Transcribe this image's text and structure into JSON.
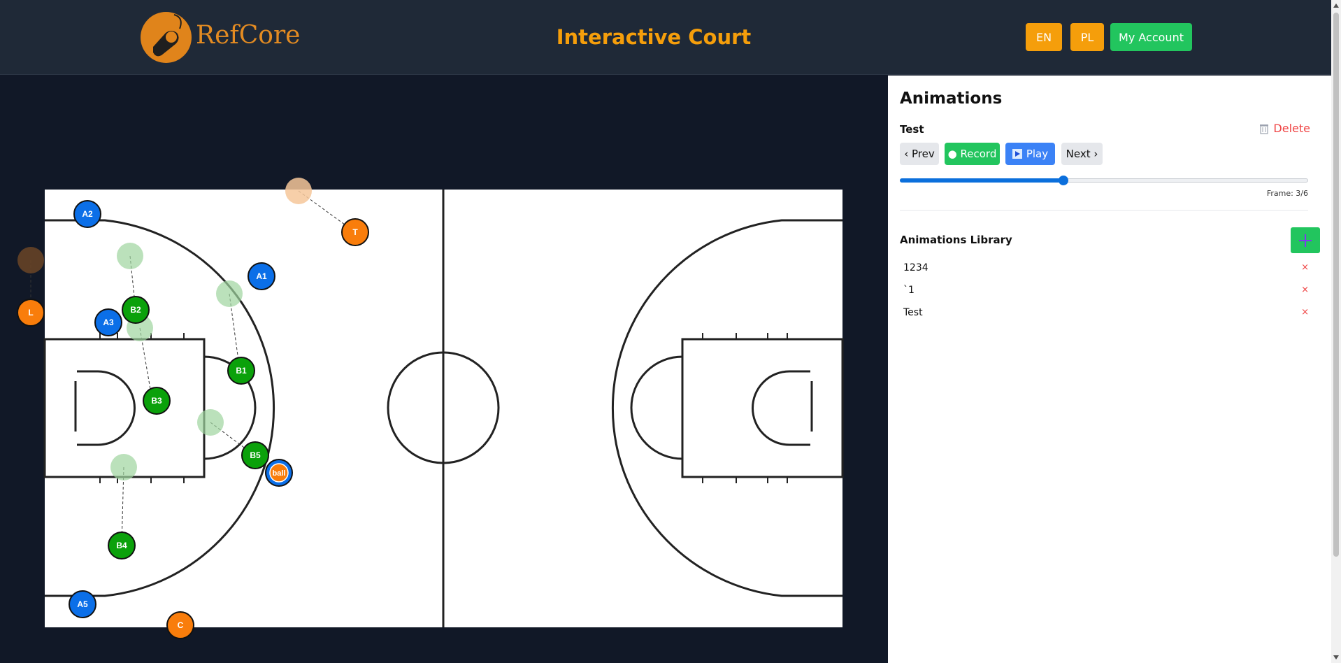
{
  "header": {
    "logo_text": "RefCore",
    "title": "Interactive Court",
    "lang_en": "EN",
    "lang_pl": "PL",
    "account": "My Account"
  },
  "court": {
    "players": [
      {
        "label": "A1",
        "team": "A"
      },
      {
        "label": "A2",
        "team": "A"
      },
      {
        "label": "A3",
        "team": "A"
      },
      {
        "label": "A5",
        "team": "A"
      },
      {
        "label": "B1",
        "team": "B"
      },
      {
        "label": "B2",
        "team": "B"
      },
      {
        "label": "B3",
        "team": "B"
      },
      {
        "label": "B4",
        "team": "B"
      },
      {
        "label": "B5",
        "team": "B"
      },
      {
        "label": "T",
        "team": "ref"
      },
      {
        "label": "L",
        "team": "ref"
      },
      {
        "label": "C",
        "team": "ref"
      },
      {
        "label": "ball",
        "team": "ball"
      }
    ]
  },
  "panel": {
    "title": "Animations",
    "current_animation": "Test",
    "delete_label": "Delete",
    "prev_label": "‹ Prev",
    "record_label": "● Record",
    "play_label": "Play",
    "next_label": "Next ›",
    "frame_label": "Frame: 3/6",
    "frame_progress": 0.4,
    "library_title": "Animations Library",
    "library": [
      {
        "name": "1234",
        "remove": "×"
      },
      {
        "name": "`1",
        "remove": "×"
      },
      {
        "name": "Test",
        "remove": "×"
      }
    ]
  },
  "colors": {
    "header_bg": "#1f2937",
    "page_bg": "#111827",
    "accent_orange": "#f59e0b",
    "team_a_blue": "#0b6fe8",
    "team_b_green": "#0ba10b",
    "ref_orange": "#f97d0b"
  }
}
